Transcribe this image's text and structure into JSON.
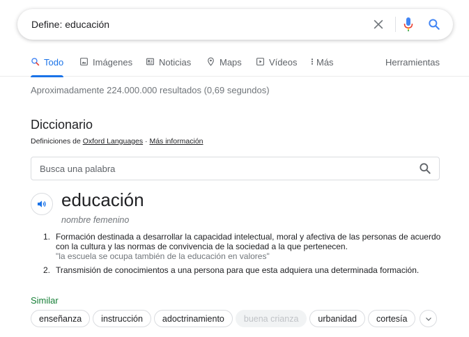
{
  "search": {
    "query": "Define: educación"
  },
  "tabs": [
    {
      "label": "Todo",
      "icon": "search-icon",
      "active": true
    },
    {
      "label": "Imágenes",
      "icon": "image-icon"
    },
    {
      "label": "Noticias",
      "icon": "news-icon"
    },
    {
      "label": "Maps",
      "icon": "map-pin-icon"
    },
    {
      "label": "Vídeos",
      "icon": "play-icon"
    },
    {
      "label": "Más",
      "icon": "more-vert-icon"
    }
  ],
  "tools_label": "Herramientas",
  "results_info": "Aproximadamente 224.000.000 resultados (0,69 segundos)",
  "dictionary": {
    "title": "Diccionario",
    "source_prefix": "Definiciones de ",
    "source_link": "Oxford Languages",
    "separator": " · ",
    "more_info": "Más información",
    "search_placeholder": "Busca una palabra",
    "word": "educación",
    "part_of_speech": "nombre femenino",
    "definitions": [
      {
        "num": "1.",
        "text": "Formación destinada a desarrollar la capacidad intelectual, moral y afectiva de las personas de acuerdo con la cultura y las normas de convivencia de la sociedad a la que pertenecen.",
        "example": "\"la escuela se ocupa también de la educación en valores\""
      },
      {
        "num": "2.",
        "text": "Transmisión de conocimientos a una persona para que esta adquiera una determinada formación.",
        "example": ""
      }
    ],
    "similar_label": "Similar",
    "similar": [
      {
        "label": "enseñanza"
      },
      {
        "label": "instrucción"
      },
      {
        "label": "adoctrinamiento"
      },
      {
        "label": "buena crianza",
        "disabled": true
      },
      {
        "label": "urbanidad"
      },
      {
        "label": "cortesía"
      }
    ]
  },
  "colors": {
    "accent": "#1a73e8",
    "similar_green": "#188038",
    "muted": "#70757a"
  }
}
